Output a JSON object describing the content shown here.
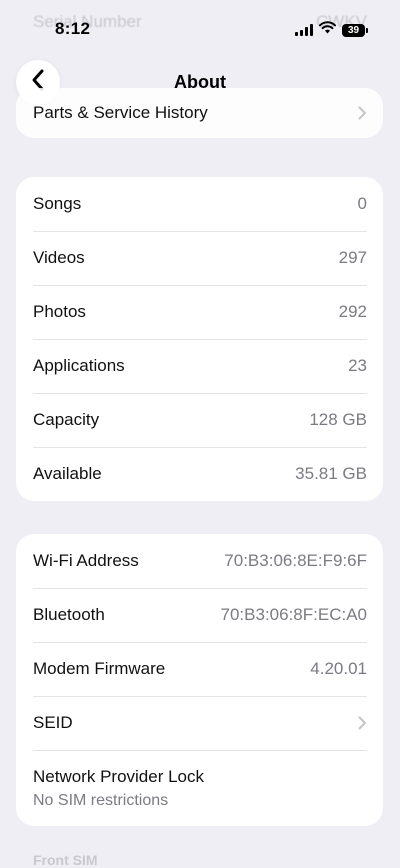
{
  "status_bar": {
    "time": "8:12",
    "battery": "39"
  },
  "nav": {
    "title": "About"
  },
  "faded_header": {
    "left": "Serial Number",
    "right": "CWKV"
  },
  "top_card": {
    "label": "Parts & Service History"
  },
  "media_rows": [
    {
      "label": "Songs",
      "value": "0"
    },
    {
      "label": "Videos",
      "value": "297"
    },
    {
      "label": "Photos",
      "value": "292"
    },
    {
      "label": "Applications",
      "value": "23"
    },
    {
      "label": "Capacity",
      "value": "128 GB"
    },
    {
      "label": "Available",
      "value": "35.81 GB"
    }
  ],
  "network_rows": [
    {
      "label": "Wi-Fi Address",
      "value": "70:B3:06:8E:F9:6F"
    },
    {
      "label": "Bluetooth",
      "value": "70:B3:06:8F:EC:A0"
    },
    {
      "label": "Modem Firmware",
      "value": "4.20.01"
    },
    {
      "label": "SEID"
    }
  ],
  "network_lock": {
    "label": "Network Provider Lock",
    "value": "No SIM restrictions"
  },
  "next_section": "Front SIM"
}
